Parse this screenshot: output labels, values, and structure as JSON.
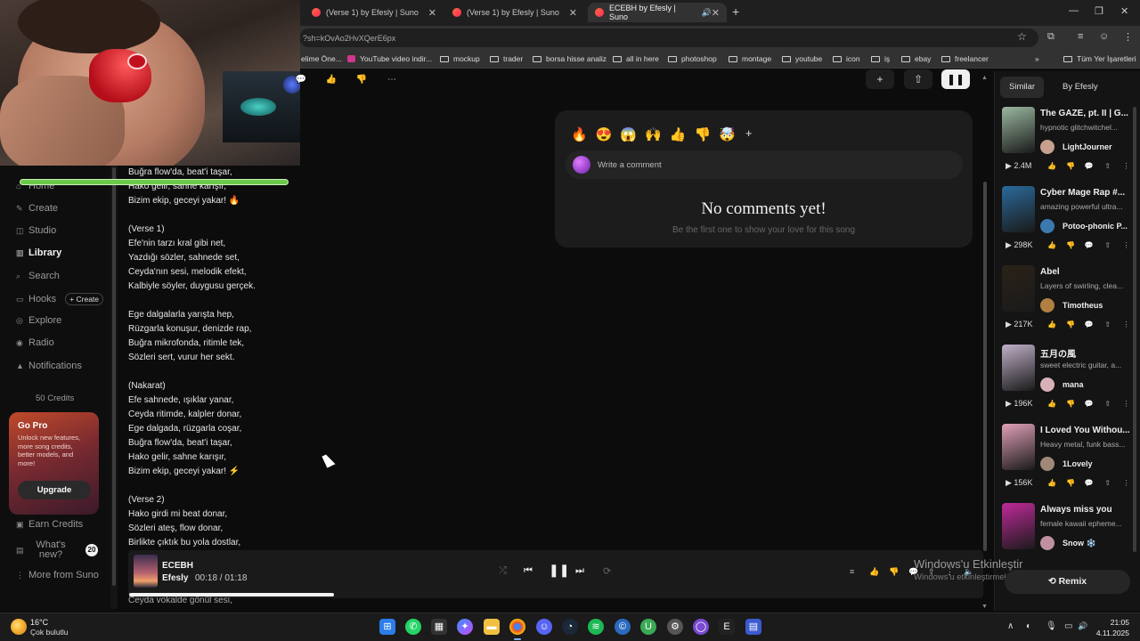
{
  "browser": {
    "tabs": [
      {
        "title": "(Verse 1) by Efesly | Suno"
      },
      {
        "title": "(Verse 1) by Efesly | Suno"
      },
      {
        "title": "ECEBH by Efesly | Suno"
      }
    ],
    "url": "?sh=kOvAo2HvXQerE6px",
    "bookmarks": [
      "elime Öne...",
      "YouTube video indir...",
      "mockup",
      "trader",
      "borsa hisse analiz",
      "all in here",
      "photoshop",
      "montage",
      "youtube",
      "icon",
      "iş",
      "ebay",
      "freelancer"
    ],
    "all_bookmarks": "Tüm Yer İşaretleri"
  },
  "sidebar": {
    "items": [
      {
        "label": "Home"
      },
      {
        "label": "Create"
      },
      {
        "label": "Studio"
      },
      {
        "label": "Library"
      },
      {
        "label": "Search"
      },
      {
        "label": "Hooks"
      },
      {
        "label": "Explore"
      },
      {
        "label": "Radio"
      },
      {
        "label": "Notifications"
      }
    ],
    "hooks_create": "+ Create",
    "credits": "50 Credits",
    "gopro": {
      "title": "Go Pro",
      "desc": "Unlock new features, more song credits, better models, and more!",
      "button": "Upgrade"
    },
    "earn_credits": "Earn Credits",
    "whats_new": "What's new?",
    "whats_new_count": "20",
    "more_from_suno": "More from Suno"
  },
  "lyrics": [
    "Buğra flow'da, beat'i taşar,",
    "Hako gelir, sahne karışır,",
    "Bizim ekip, geceyi yakar! 🔥",
    "",
    "(Verse 1)",
    "Efe'nin tarzı kral gibi net,",
    "Yazdığı sözler, sahnede set,",
    "Ceyda'nın sesi, melodik efekt,",
    "Kalbiyle söyler, duygusu gerçek.",
    "",
    "Ege dalgalarla yarışta hep,",
    "Rüzgarla konuşur, denizde rap,",
    "Buğra mikrofonda, ritimle tek,",
    "Sözleri sert, vurur her sekt.",
    "",
    "(Nakarat)",
    "Efe sahnede, ışıklar yanar,",
    "Ceyda ritimde, kalpler donar,",
    "Ege dalgada, rüzgarla coşar,",
    "Buğra flow'da, beat'i taşar,",
    "Hako gelir, sahne karışır,",
    "Bizim ekip, geceyi yakar! ⚡",
    "",
    "(Verse 2)",
    "Hako girdi mi beat donar,",
    "Sözleri ateş, flow donar,",
    "Birlikte çıktık bu yola dostlar,"
  ],
  "lyric_under_player": "Ceyda vokalde gönül sesi,",
  "comments": {
    "emojis": [
      "🔥",
      "😍",
      "😱",
      "🙌",
      "👍",
      "👎",
      "🤯"
    ],
    "add": "+",
    "placeholder": "Write a comment",
    "empty_title": "No comments yet!",
    "empty_sub": "Be the first one to show your love for this song"
  },
  "right_panel": {
    "tabs": [
      "Similar",
      "By Efesly"
    ],
    "cards": [
      {
        "title": "The GAZE, pt. II | G...",
        "desc": "hypnotic glitchwitchel...",
        "user": "LightJourner",
        "plays": "2.4M",
        "thumb": "#9ab8a0",
        "avatar": "#c8a090"
      },
      {
        "title": "Cyber Mage Rap #...",
        "desc": "amazing powerful ultra...",
        "user": "Potoo-phonic P...",
        "plays": "298K",
        "thumb": "#2a6a9a",
        "avatar": "#3a7ab0"
      },
      {
        "title": "Abel",
        "desc": "Layers of swirling, clea...",
        "user": "Timotheus",
        "plays": "217K",
        "thumb": "#2a2218",
        "avatar": "#b08040"
      },
      {
        "title": "五月の風",
        "desc": "sweet electric guitar, a...",
        "user": "mana",
        "plays": "196K",
        "thumb": "#c0b0c8",
        "avatar": "#d8b0b8"
      },
      {
        "title": "I Loved You Withou...",
        "desc": "Heavy metal, funk bass...",
        "user": "1Lovely",
        "plays": "156K",
        "thumb": "#e0a0b8",
        "avatar": "#a08878"
      },
      {
        "title": "Always miss you",
        "desc": "female kawaii epheme...",
        "user": "Snow ❄️",
        "plays": "",
        "thumb": "#c02a9a",
        "avatar": "#c090a0"
      }
    ]
  },
  "player": {
    "title": "ECEBH",
    "artist": "Efesly",
    "time": "00:18 / 01:18",
    "progress": 0.23
  },
  "remix": "Remix",
  "watermark": {
    "line1": "Windows'u Etkinleştir",
    "line2": "Windows'u etkinleştirmek için Ayarlar'a gidin."
  },
  "taskbar": {
    "temp": "16°C",
    "weather": "Çok bulutlu",
    "time": "21:05",
    "date": "4.11.2025"
  }
}
